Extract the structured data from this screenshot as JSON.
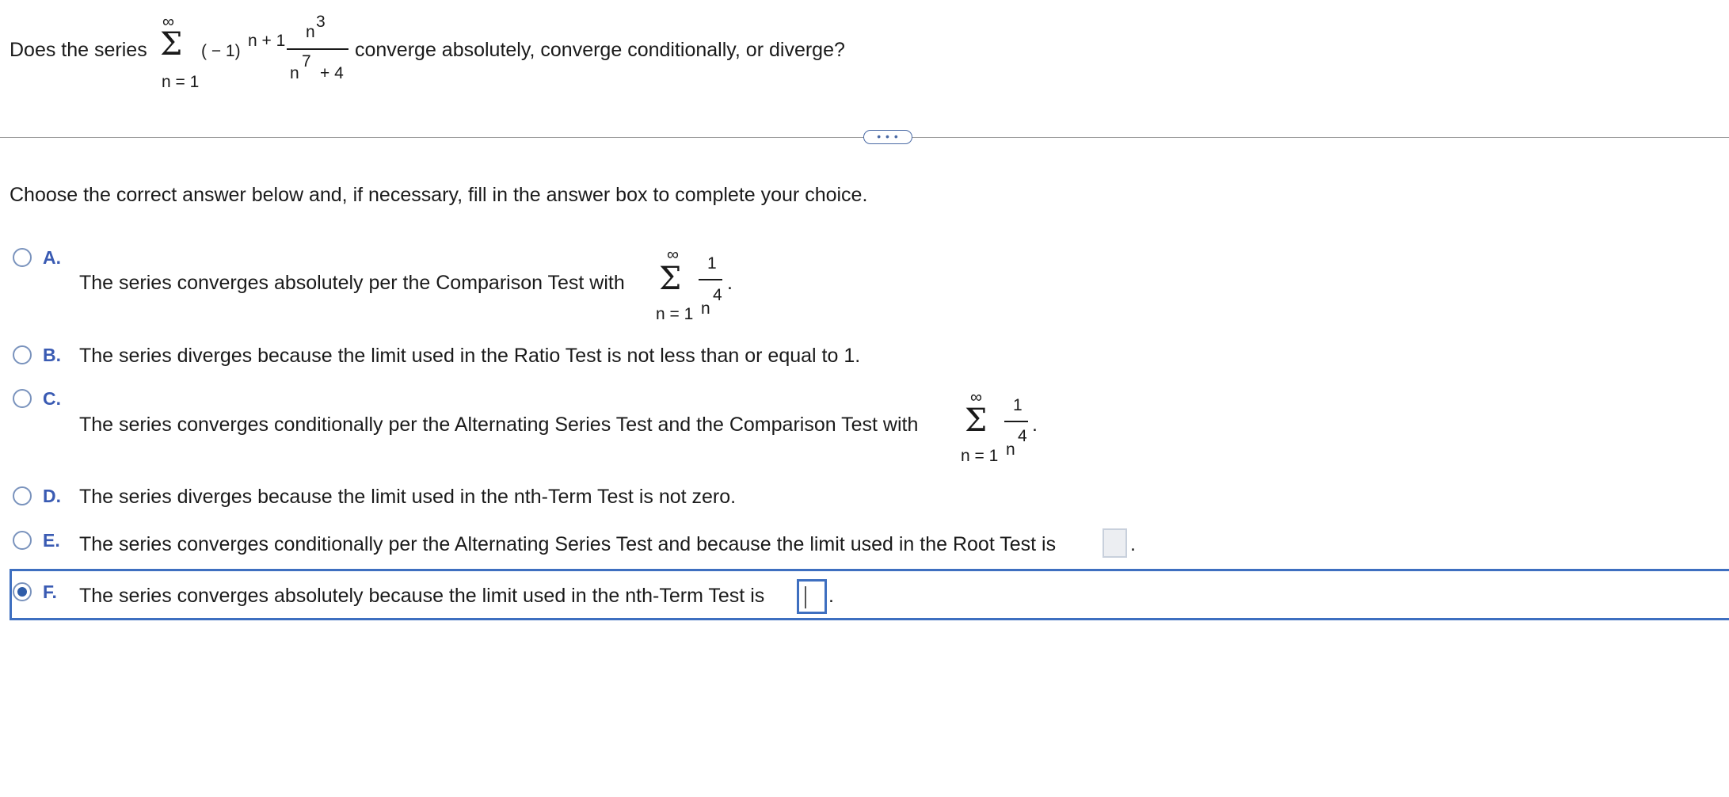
{
  "question": {
    "prefix": "Does the series",
    "sum_top": "∞",
    "sum_bottom": "n = 1",
    "sign_base": "( − 1)",
    "sign_exp": "n + 1",
    "numerator_base": "n",
    "numerator_exp": "3",
    "denominator_base": "n",
    "denominator_exp": "7",
    "denominator_tail": "+ 4",
    "suffix": "converge absolutely, converge conditionally, or diverge?"
  },
  "more_button_label": "• • •",
  "instruction": "Choose the correct answer below and, if necessary, fill in the answer box to complete your choice.",
  "options": {
    "a": {
      "letter": "A.",
      "text": "The series converges absolutely per the Comparison Test with",
      "sum_top": "∞",
      "sum_bottom": "n = 1",
      "numerator": "1",
      "denominator_base": "n",
      "denominator_exp": "4",
      "tail": "."
    },
    "b": {
      "letter": "B.",
      "text": "The series diverges because the limit used in the Ratio Test is not less than or equal to 1."
    },
    "c": {
      "letter": "C.",
      "text": "The series converges conditionally per the Alternating Series Test and the Comparison Test with",
      "sum_top": "∞",
      "sum_bottom": "n = 1",
      "numerator": "1",
      "denominator_base": "n",
      "denominator_exp": "4",
      "tail": "."
    },
    "d": {
      "letter": "D.",
      "text": "The series diverges because the limit used in the nth-Term Test is not zero."
    },
    "e": {
      "letter": "E.",
      "text": "The series converges conditionally per the Alternating Series Test and because the limit used in the Root Test is",
      "tail": "."
    },
    "f": {
      "letter": "F.",
      "text": "The series converges absolutely because the limit used in the nth-Term Test is",
      "tail": "."
    }
  },
  "selected_option": "F",
  "answer_inputs": {
    "e_value": "",
    "f_value": ""
  }
}
